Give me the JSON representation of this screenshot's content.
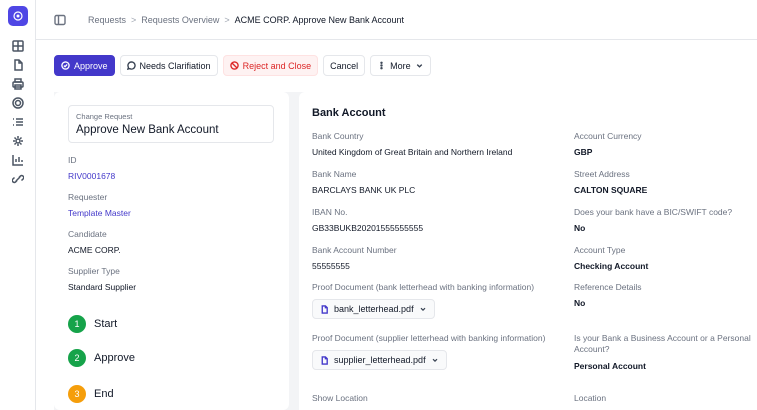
{
  "sidebar": {
    "logo": "app-logo",
    "icons": [
      "grid-icon",
      "document-icon",
      "printer-icon",
      "target-icon",
      "list-icon",
      "gear-icon",
      "chart-icon",
      "link-icon"
    ]
  },
  "breadcrumb": {
    "items": [
      "Requests",
      "Requests Overview"
    ],
    "separator": ">",
    "current": "ACME CORP. Approve New Bank Account"
  },
  "toolbar": {
    "approve_label": "Approve",
    "clarification_label": "Needs Clarifiation",
    "reject_label": "Reject and Close",
    "cancel_label": "Cancel",
    "more_label": "More"
  },
  "request": {
    "change_request_label": "Change Request",
    "change_request_title": "Approve New Bank Account",
    "id_label": "ID",
    "id_value": "RIV0001678",
    "requester_label": "Requester",
    "requester_value": "Template Master",
    "candidate_label": "Candidate",
    "candidate_value": "ACME CORP.",
    "supplier_type_label": "Supplier Type",
    "supplier_type_value": "Standard Supplier"
  },
  "steps": [
    {
      "number": "1",
      "label": "Start",
      "status": "done"
    },
    {
      "number": "2",
      "label": "Approve",
      "status": "done"
    },
    {
      "number": "3",
      "label": "End",
      "status": "pending"
    }
  ],
  "bank_account": {
    "title": "Bank Account",
    "bank_country_label": "Bank Country",
    "bank_country_value": "United Kingdom of Great Britain and Northern Ireland",
    "account_currency_label": "Account Currency",
    "account_currency_value": "GBP",
    "bank_name_label": "Bank Name",
    "bank_name_value": "BARCLAYS BANK UK PLC",
    "street_address_label": "Street Address",
    "street_address_value": "CALTON SQUARE",
    "iban_label": "IBAN No.",
    "iban_value": "GB33BUKB20201555555555",
    "bic_label": "Does your bank have a BIC/SWIFT code?",
    "bic_value": "No",
    "account_number_label": "Bank Account Number",
    "account_number_value": "55555555",
    "account_type_label": "Account Type",
    "account_type_value": "Checking Account",
    "proof_bank_label": "Proof Document (bank letterhead with banking information)",
    "proof_bank_file": "bank_letterhead.pdf",
    "reference_label": "Reference Details",
    "reference_value": "No",
    "proof_supplier_label": "Proof Document (supplier letterhead with banking information)",
    "proof_supplier_file": "supplier_letterhead.pdf",
    "business_personal_label": "Is your Bank a Business Account or a Personal Account?",
    "business_personal_value": "Personal Account",
    "show_location_label": "Show Location",
    "location_label": "Location"
  },
  "colors": {
    "primary": "#4338ca",
    "danger": "#dc2626",
    "success": "#16a34a",
    "warning": "#f59e0b"
  }
}
